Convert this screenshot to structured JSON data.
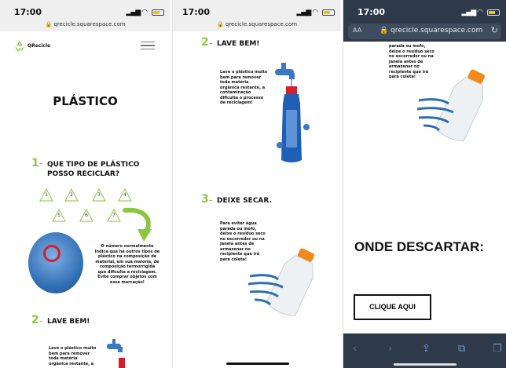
{
  "status": {
    "time_1": "17:00",
    "time_2": "17:00",
    "time_3": "17:00",
    "url_short": "qrecicle.squarespace.com",
    "url_short_2": "qrecicle.squarespace.com"
  },
  "browser": {
    "aa_label": "AA",
    "address": "qrecicle.squarespace.com"
  },
  "site": {
    "logo_text": "QRecicle",
    "page_title": "PLÁSTICO"
  },
  "step1": {
    "number": "1",
    "title_line1": "QUE TIPO DE PLÁSTICO",
    "title_line2": "POSSO RECICLAR?",
    "codes": [
      "1",
      "2",
      "3",
      "4",
      "5",
      "6",
      "7"
    ],
    "description_lines": [
      "O número   normalmente",
      "indica que há outros tipos de",
      "plástico na composição de",
      "material, em sua maioria, de",
      "composição termorrígida",
      "que dificulta a reciclagem.",
      "Evite comprar objetos com",
      "essa marcação!"
    ]
  },
  "step2": {
    "number": "2",
    "title": "LAVE BEM!",
    "description_lines": [
      "Lave o plástico muito",
      "bem para remover",
      "toda matéria",
      "orgânica restante, a",
      "contaminação",
      "dificulta o processo",
      "de reciclagem!"
    ],
    "partial_lines": [
      "Lave o plástico muito",
      "bem para remover",
      "toda matéria",
      "orgânica restante, a"
    ]
  },
  "step3": {
    "number": "3",
    "title": "DEIXE SECAR.",
    "description_lines": [
      "Para evitar água",
      "parada ou mofo,",
      "deixe o resíduo seco",
      "no escorredor ou na",
      "janela antes de",
      "armazenar no",
      "recipiente que irá",
      "para coleta!"
    ]
  },
  "onde": {
    "heading": "ONDE DESCARTAR:",
    "button_label": "CLIQUE AQUI"
  },
  "icons": {
    "recycle": "recycle-icon",
    "menu": "hamburger-menu-icon",
    "lock": "lock-icon",
    "reload": "reload-icon",
    "back": "back-arrow-icon",
    "forward": "forward-arrow-icon",
    "share": "share-icon",
    "bookmarks": "book-icon",
    "tabs": "tabs-icon"
  },
  "colors": {
    "accent_green": "#8cc63f",
    "bottle_cap_orange": "#f28a1b",
    "wind_blue": "#2f6db3",
    "circle_red": "#d4202a",
    "browser_bar": "#2e3a4a"
  }
}
